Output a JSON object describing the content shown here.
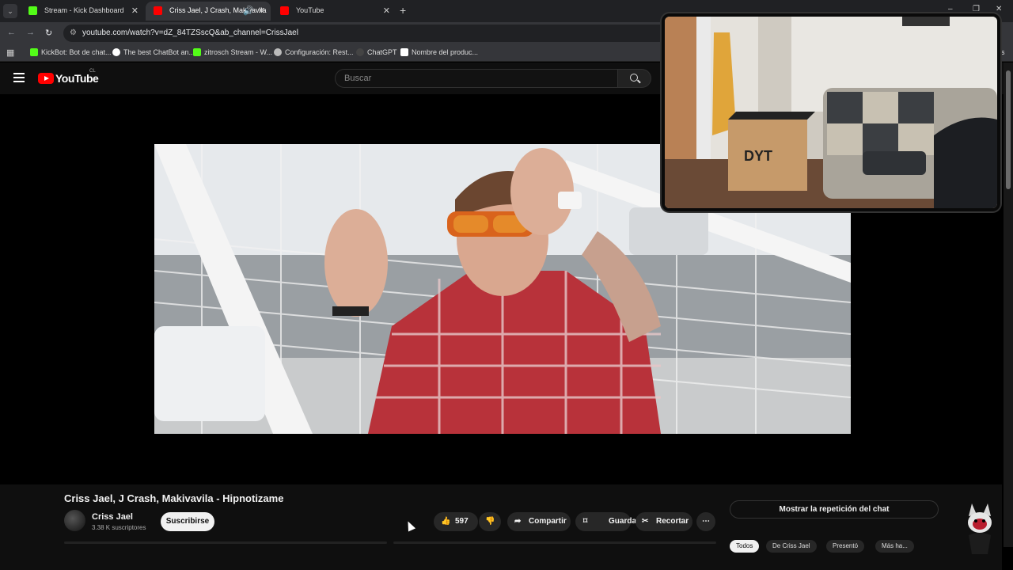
{
  "browser": {
    "tabs": [
      {
        "label": "Stream - Kick Dashboard",
        "favicon_color": "#53fc18",
        "active": false
      },
      {
        "label": "Criss Jael, J Crash, Makivavila",
        "favicon_color": "#ff0000",
        "active": true
      },
      {
        "label": "YouTube",
        "favicon_color": "#ff0000",
        "active": false
      }
    ],
    "tab_menu_glyph": "⌄",
    "new_tab_glyph": "+",
    "window_controls": [
      "–",
      "❐",
      "✕"
    ],
    "url": "youtube.com/watch?v=dZ_84TZSscQ&ab_channel=CrissJael",
    "bookmarks": [
      {
        "label": "KickBot: Bot de chat...",
        "color": "#53fc18"
      },
      {
        "label": "The best ChatBot an...",
        "color": "#ffffff"
      },
      {
        "label": "zitrosch Stream - W...",
        "color": "#53fc18"
      },
      {
        "label": "Configuración: Rest...",
        "color": "#bbbbbb"
      },
      {
        "label": "ChatGPT",
        "color": "#222222"
      },
      {
        "label": "Nombre del produc...",
        "color": "#ffffff"
      }
    ],
    "bookmarks_overflow": "os"
  },
  "youtube": {
    "logo_text": "YouTube",
    "region": "CL",
    "search_placeholder": "Buscar",
    "video_title": "Criss Jael, J Crash, Makivavila - Hipnotizame",
    "channel_name": "Criss Jael",
    "subscribers": "3.38 K suscriptores",
    "subscribe_label": "Suscribirse",
    "like_count": "597",
    "share_label": "Compartir",
    "save_label": "Guardar",
    "clip_label": "Recortar",
    "more_glyph": "⋯",
    "chat_replay_label": "Mostrar la repetición del chat",
    "chips": [
      "Todos",
      "De Criss Jael",
      "Presentó",
      "Más ha..."
    ]
  },
  "colors": {
    "accent": "#ff0000",
    "background": "#0f0f0f",
    "kick_green": "#53fc18"
  }
}
